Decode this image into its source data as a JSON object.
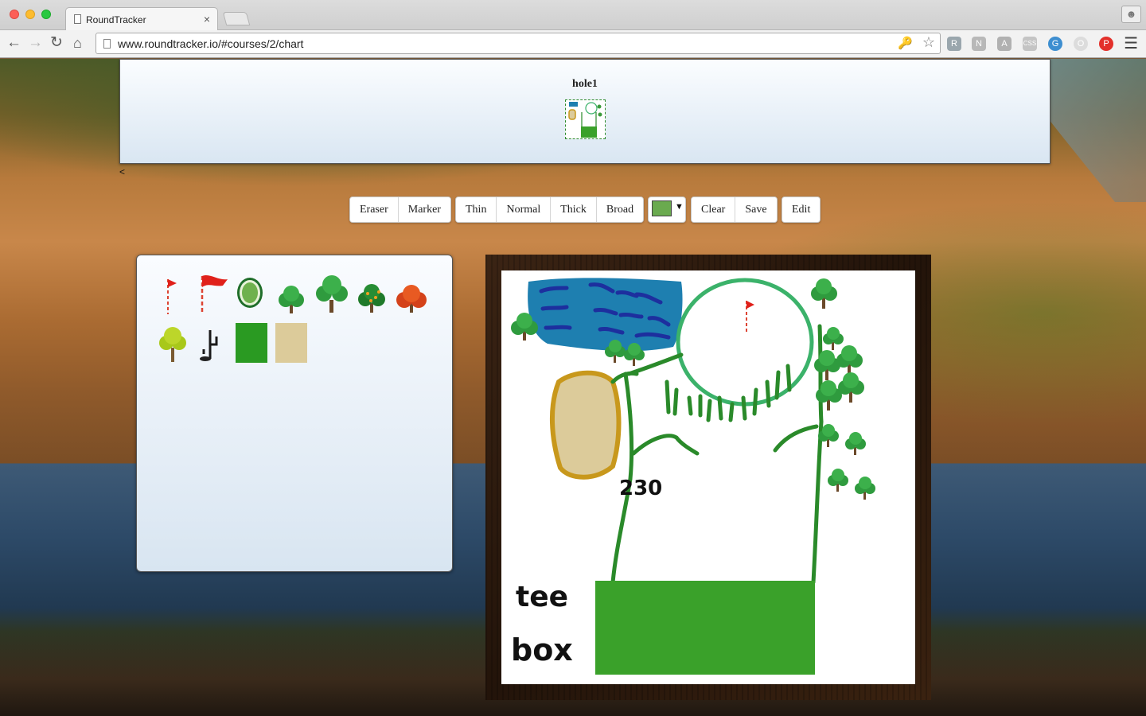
{
  "browser": {
    "tab_title": "RoundTracker",
    "tab_close": "×",
    "url": "www.roundtracker.io/#courses/2/chart",
    "extensions": [
      "R",
      "N",
      "A",
      "CSS",
      "G",
      "O",
      "P"
    ]
  },
  "header": {
    "hole_title": "hole1",
    "back_link": "<"
  },
  "toolbar": {
    "tools": [
      "Eraser",
      "Marker"
    ],
    "sizes": [
      "Thin",
      "Normal",
      "Thick",
      "Broad"
    ],
    "color": "#6aaa4f",
    "color_arrow": "▼",
    "actions": [
      "Clear",
      "Save"
    ],
    "edit": "Edit"
  },
  "palette": {
    "stamps": [
      "small-flag-icon",
      "large-flag-icon",
      "green-icon",
      "small-tree-icon",
      "large-tree-icon",
      "orange-tree-icon",
      "autumn-tree-icon",
      "yellow-tree-icon",
      "cactus-icon",
      "fairway-tile",
      "sand-tile"
    ]
  },
  "drawing": {
    "yardage": "230",
    "tee_line1": "tee",
    "tee_line2": "box"
  },
  "colors": {
    "fairway": "#3aa12a",
    "sand": "#dccb9a",
    "sand_outline": "#c8981c",
    "water": "#1e7fb0",
    "water_lines": "#1d2f9e",
    "ink_green": "#2a8a2a",
    "green_outline": "#3bb26a"
  }
}
